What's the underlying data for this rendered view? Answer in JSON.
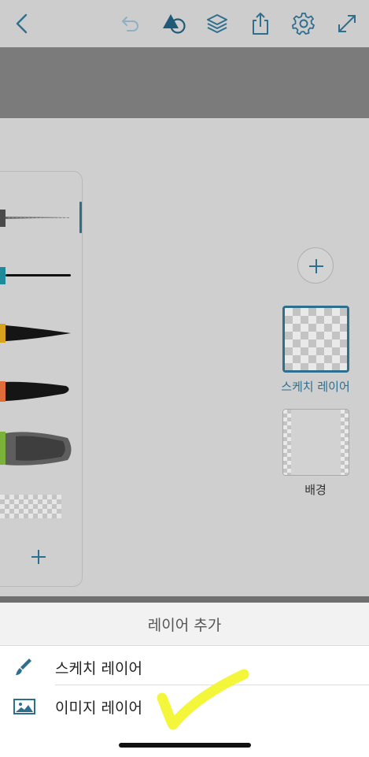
{
  "toolbar": {
    "icons": [
      "back-icon",
      "undo-icon",
      "shapes-icon",
      "layers-icon",
      "share-icon",
      "settings-icon",
      "fullscreen-icon"
    ],
    "accent_color": "#2e6f8e"
  },
  "brush_panel": {
    "brushes": [
      {
        "name": "pencil",
        "color": "#4a4a4a"
      },
      {
        "name": "ink-pen",
        "color": "#1f8a99"
      },
      {
        "name": "pencil-brush",
        "color": "#d9a21c"
      },
      {
        "name": "marker",
        "color": "#e06c3a"
      },
      {
        "name": "watercolor",
        "color": "#7bb33a"
      },
      {
        "name": "eraser",
        "color": "#bbbbbb"
      }
    ],
    "add_icon": "plus-icon"
  },
  "layers": {
    "add_icon": "plus-icon",
    "items": [
      {
        "label": "스케치 레이어",
        "selected": true
      },
      {
        "label": "배경",
        "selected": false
      }
    ]
  },
  "sheet": {
    "title": "레이어 추가",
    "options": [
      {
        "label": "스케치 레이어",
        "icon": "brush-icon"
      },
      {
        "label": "이미지 레이어",
        "icon": "image-icon"
      }
    ]
  },
  "annotation": {
    "icon": "checkmark-icon",
    "color": "#f3f52a"
  }
}
